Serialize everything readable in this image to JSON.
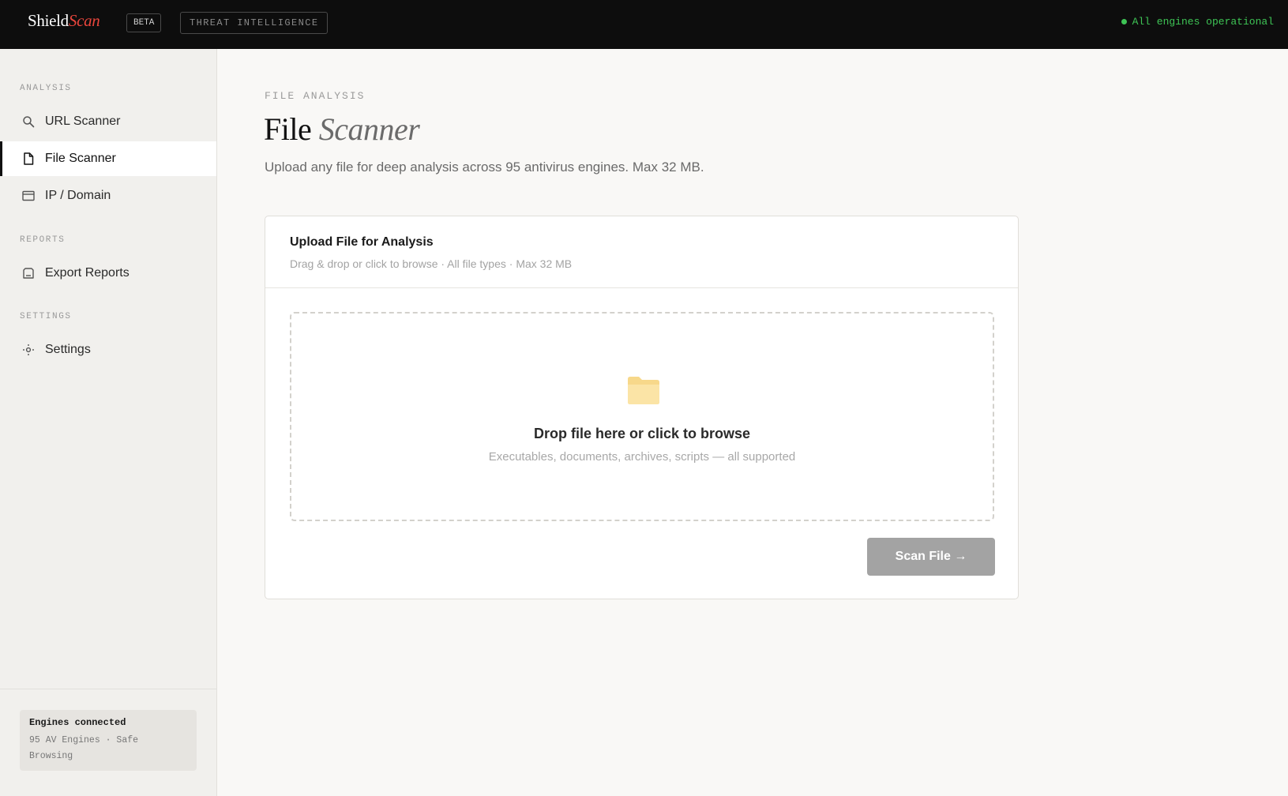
{
  "header": {
    "brand_primary": "Shield",
    "brand_accent": "Scan",
    "beta_badge": "BETA",
    "section_tag": "THREAT INTELLIGENCE",
    "status_text": "All engines operational",
    "status_color": "#3ec455",
    "accent_color": "#e8453c"
  },
  "sidebar": {
    "sections": [
      {
        "label": "ANALYSIS",
        "items": [
          {
            "label": "URL Scanner",
            "icon": "search-icon",
            "active": false
          },
          {
            "label": "File Scanner",
            "icon": "file-icon",
            "active": true
          },
          {
            "label": "IP / Domain",
            "icon": "browser-window-icon",
            "active": false
          }
        ]
      },
      {
        "label": "REPORTS",
        "items": [
          {
            "label": "Export Reports",
            "icon": "document-export-icon",
            "active": false
          }
        ]
      },
      {
        "label": "SETTINGS",
        "items": [
          {
            "label": "Settings",
            "icon": "gear-icon",
            "active": false
          }
        ]
      }
    ],
    "footer": {
      "title": "Engines connected",
      "detail": "95 AV Engines · Safe Browsing"
    }
  },
  "main": {
    "eyebrow": "FILE ANALYSIS",
    "title_primary": "File",
    "title_accent": "Scanner",
    "subtitle": "Upload any file for deep analysis across 95 antivirus engines. Max 32 MB.",
    "upload_card": {
      "title": "Upload File for Analysis",
      "subtitle": "Drag & drop or click to browse · All file types · Max 32 MB",
      "dropzone_icon": "folder-icon",
      "dropzone_title": "Drop file here or click to browse",
      "dropzone_subtitle": "Executables, documents, archives, scripts — all supported",
      "scan_button": "Scan File →"
    }
  }
}
